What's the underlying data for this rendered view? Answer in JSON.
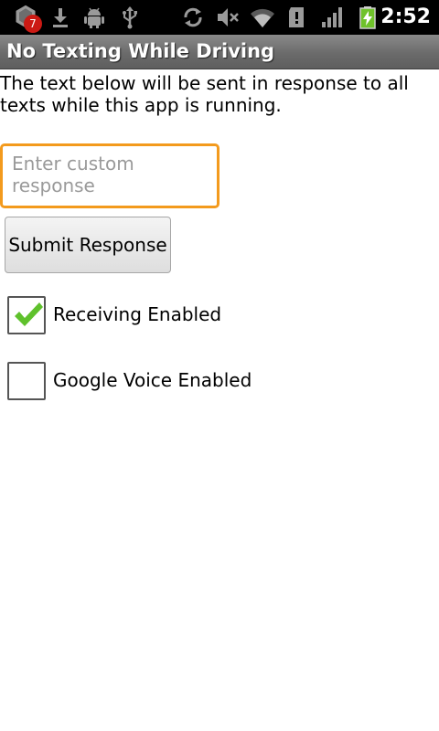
{
  "status_bar": {
    "notification_count": "7",
    "time": "2:52",
    "icons": [
      "notification-app-icon",
      "download-icon",
      "android-debug-icon",
      "usb-icon",
      "sync-icon",
      "mute-icon",
      "wifi-icon",
      "sd-card-icon",
      "signal-icon",
      "battery-charging-icon"
    ]
  },
  "app": {
    "title": "No Texting While Driving"
  },
  "main": {
    "description": "The text below will be sent in response to all texts while this app is running.",
    "response_input": {
      "value": "",
      "placeholder": "Enter custom response"
    },
    "submit_label": "Submit Response",
    "options": [
      {
        "label": "Receiving Enabled",
        "checked": true
      },
      {
        "label": "Google Voice Enabled",
        "checked": false
      }
    ]
  },
  "colors": {
    "focus_border": "#f39a1d",
    "check_green": "#5fc12c",
    "title_bar": "#6b6b6b"
  }
}
